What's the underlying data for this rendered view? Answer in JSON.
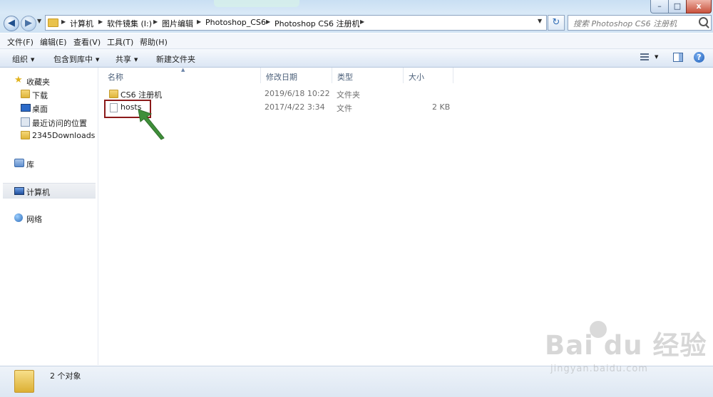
{
  "window": {
    "min_glyph": "–",
    "max_glyph": "□",
    "close_glyph": "x"
  },
  "address": {
    "crumbs": [
      "计算机",
      "软件镜集 (I:)",
      "图片编辑",
      "Photoshop_CS6",
      "Photoshop CS6 注册机"
    ]
  },
  "search": {
    "placeholder": "搜索 Photoshop CS6 注册机"
  },
  "menu": [
    "文件(F)",
    "编辑(E)",
    "查看(V)",
    "工具(T)",
    "帮助(H)"
  ],
  "toolbar": {
    "organize": "组织",
    "include_in_library": "包含到库中",
    "share": "共享",
    "new_folder": "新建文件夹"
  },
  "sidebar": {
    "favorites": "收藏夹",
    "fav_items": [
      "下载",
      "桌面",
      "最近访问的位置",
      "2345Downloads"
    ],
    "libraries": "库",
    "computer": "计算机",
    "network": "网络"
  },
  "columns": {
    "name": "名称",
    "date": "修改日期",
    "type": "类型",
    "size": "大小"
  },
  "files": [
    {
      "name": "CS6 注册机",
      "date": "2019/6/18 10:22",
      "type": "文件夹",
      "size": "",
      "icon": "folder-icon"
    },
    {
      "name": "hosts",
      "date": "2017/4/22 3:34",
      "type": "文件",
      "size": "2 KB",
      "icon": "file-icon"
    }
  ],
  "status": {
    "text": "2 个对象"
  },
  "watermark": {
    "logo": "Bai du 经验",
    "url": "jingyan.baidu.com"
  },
  "colors": {
    "highlight": "#8b1a1a",
    "arrow": "#3f8f3a"
  }
}
